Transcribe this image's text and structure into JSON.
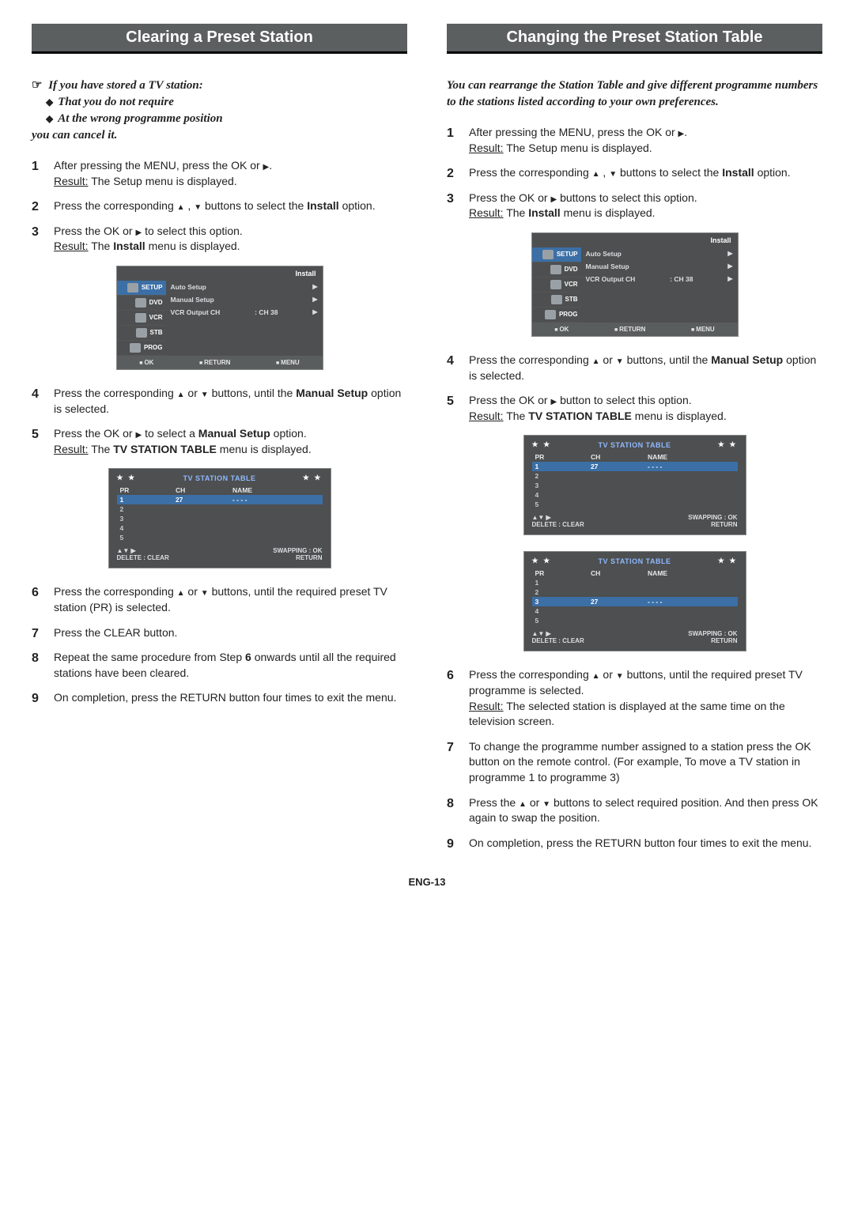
{
  "page_footer": "ENG-13",
  "left": {
    "title": "Clearing a Preset Station",
    "intro_line1": "If you have stored a TV station:",
    "intro_bullet1": "That you do not require",
    "intro_bullet2": "At the wrong programme position",
    "intro_line2": "you can cancel it.",
    "step1a": "After pressing the MENU, press the OK or ",
    "step1b": ".",
    "step1r_label": "Result:",
    "step1r": "  The Setup menu is displayed.",
    "step2a": "Press the corresponding ",
    "step2b": " , ",
    "step2c": " buttons to select the ",
    "step2d": "Install",
    "step2e": " option.",
    "step3a": "Press the OK or ",
    "step3b": " to select this option.",
    "step3r_label": "Result:",
    "step3r1": "  The ",
    "step3r2": "Install",
    "step3r3": " menu is displayed.",
    "step4a": "Press the corresponding ",
    "step4b": " or ",
    "step4c": " buttons, until the ",
    "step4d": "Manual Setup",
    "step4e": " option is selected.",
    "step5a": "Press the OK or ",
    "step5b": " to select a ",
    "step5c": "Manual Setup",
    "step5d": " option.",
    "step5r_label": "Result:",
    "step5r1": "  The ",
    "step5r2": "TV STATION TABLE",
    "step5r3": " menu is displayed.",
    "step6a": "Press the corresponding ",
    "step6b": " or ",
    "step6c": " buttons, until the required preset TV station (PR) is selected.",
    "step7": "Press the CLEAR button.",
    "step8a": "Repeat the same procedure from Step ",
    "step8b": "6",
    "step8c": " onwards until all the required stations have been cleared.",
    "step9": "On completion, press the RETURN button four times to exit the menu."
  },
  "right": {
    "title": "Changing the Preset Station Table",
    "intro": "You can rearrange the Station Table and give different programme numbers to the stations listed according to your own preferences.",
    "step1a": "After pressing the MENU, press the OK or ",
    "step1b": ".",
    "step1r_label": "Result:",
    "step1r": "  The Setup menu is displayed.",
    "step2a": "Press the corresponding ",
    "step2b": " , ",
    "step2c": " buttons to select the ",
    "step2d": "Install",
    "step2e": " option.",
    "step3a": "Press the OK or ",
    "step3b": " buttons to select this option.",
    "step3r_label": "Result:",
    "step3r1": "  The ",
    "step3r2": "Install",
    "step3r3": " menu is displayed.",
    "step4a": "Press the corresponding ",
    "step4b": " or ",
    "step4c": " buttons, until the ",
    "step4d": "Manual Setup",
    "step4e": " option is selected.",
    "step5a": "Press the OK or ",
    "step5b": " button to select this option.",
    "step5r_label": "Result:",
    "step5r1": "  The ",
    "step5r2": "TV STATION TABLE",
    "step5r3": " menu is displayed.",
    "step6a": "Press the corresponding ",
    "step6b": " or ",
    "step6c": " buttons, until the required preset TV programme is selected.",
    "step6r_label": "Result:",
    "step6r": "  The selected station is displayed at the same time on the television screen.",
    "step7": "To change the programme number assigned to a station press the OK button on the remote control. (For example, To move a TV station in programme 1 to programme 3)",
    "step8a": "Press the ",
    "step8b": " or ",
    "step8c": " buttons to select required position. And then press OK again to swap the position.",
    "step9": "On completion, press the RETURN button four times to exit the menu."
  },
  "osd_install": {
    "title": "Install",
    "sidebar": [
      "SETUP",
      "DVD",
      "VCR",
      "STB",
      "PROG"
    ],
    "rows": [
      {
        "label": "Auto Setup",
        "val": "",
        "arrow": "▶"
      },
      {
        "label": "Manual Setup",
        "val": "",
        "arrow": "▶"
      },
      {
        "label": "VCR Output CH",
        "val": ": CH 38",
        "arrow": "▶"
      }
    ],
    "footer": [
      "OK",
      "RETURN",
      "MENU"
    ]
  },
  "osd_table": {
    "title": "TV STATION TABLE",
    "stars": "★ ★",
    "cols": [
      "PR",
      "CH",
      "NAME"
    ],
    "rows_a": [
      {
        "pr": "1",
        "ch": "27",
        "name": "- - - -",
        "hl": true
      },
      {
        "pr": "2",
        "ch": "",
        "name": ""
      },
      {
        "pr": "3",
        "ch": "",
        "name": ""
      },
      {
        "pr": "4",
        "ch": "",
        "name": ""
      },
      {
        "pr": "5",
        "ch": "",
        "name": ""
      }
    ],
    "rows_b": [
      {
        "pr": "1",
        "ch": "",
        "name": ""
      },
      {
        "pr": "2",
        "ch": "",
        "name": ""
      },
      {
        "pr": "3",
        "ch": "27",
        "name": "- - - -",
        "hl": true
      },
      {
        "pr": "4",
        "ch": "",
        "name": ""
      },
      {
        "pr": "5",
        "ch": "",
        "name": ""
      }
    ],
    "foot_nav": "▲▼ ▶",
    "foot_delete": "DELETE  :  CLEAR",
    "foot_swap": "SWAPPING :  OK",
    "foot_return": "RETURN"
  }
}
